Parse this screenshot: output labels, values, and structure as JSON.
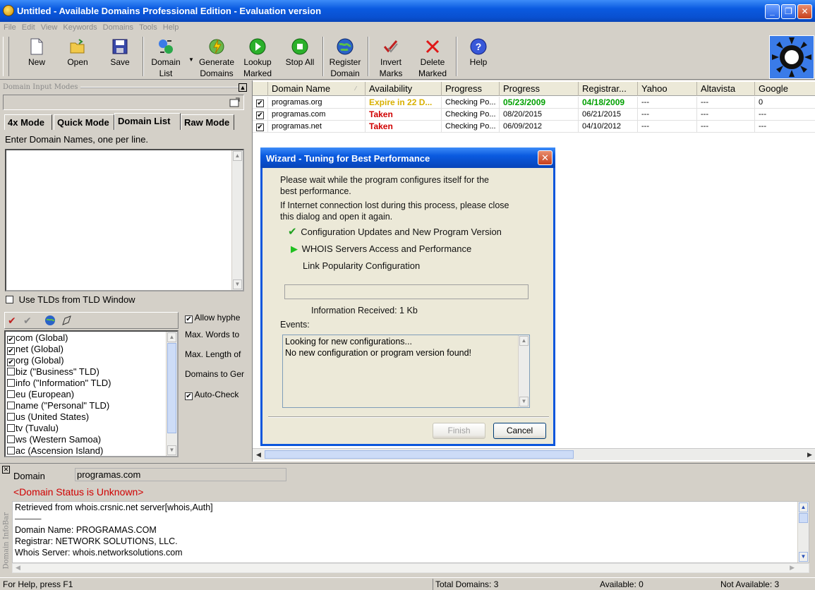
{
  "window": {
    "title": "Untitled - Available Domains Professional Edition - Evaluation version",
    "controls": [
      "_",
      "❐",
      "✕"
    ]
  },
  "menu": [
    "File",
    "Edit",
    "View",
    "Keywords",
    "Domains",
    "Tools",
    "Help"
  ],
  "toolbar": {
    "new": "New",
    "open": "Open",
    "save": "Save",
    "domain_list_1": "Domain",
    "domain_list_2": "List",
    "generate_1": "Generate",
    "generate_2": "Domains",
    "lookup_1": "Lookup",
    "lookup_2": "Marked",
    "stop_all": "Stop All",
    "register_1": "Register",
    "register_2": "Domain",
    "invert_1": "Invert",
    "invert_2": "Marks",
    "delete_1": "Delete",
    "delete_2": "Marked",
    "help": "Help",
    "icons": {
      "new": "new-file-icon",
      "open": "open-folder-icon",
      "save": "floppy-disk-icon",
      "domain_list": "domain-list-icon",
      "generate": "lightning-globe-icon",
      "lookup": "green-play-icon",
      "stop": "green-stop-icon",
      "register": "globe-icon",
      "invert": "check-marks-icon",
      "delete": "red-x-icon",
      "help": "question-icon"
    }
  },
  "left_pane": {
    "title": "Domain Input Modes",
    "tabs": [
      "4x Mode",
      "Quick Mode",
      "Domain List",
      "Raw Mode"
    ],
    "active_tab": "Domain List",
    "instruction": "Enter Domain Names, one per line.",
    "domain_text": "",
    "use_tlds_label": "Use TLDs from TLD Window",
    "use_tlds_checked": false,
    "tld_list": [
      {
        "label": "com (Global)",
        "checked": true
      },
      {
        "label": "net (Global)",
        "checked": true
      },
      {
        "label": "org (Global)",
        "checked": true
      },
      {
        "label": "biz (\"Business\" TLD)",
        "checked": false
      },
      {
        "label": "info (\"Information\" TLD)",
        "checked": false
      },
      {
        "label": "eu (European)",
        "checked": false
      },
      {
        "label": "name (\"Personal\" TLD)",
        "checked": false
      },
      {
        "label": "us (United States)",
        "checked": false
      },
      {
        "label": "tv (Tuvalu)",
        "checked": false
      },
      {
        "label": "ws (Western Samoa)",
        "checked": false
      },
      {
        "label": "ac (Ascension Island)",
        "checked": false
      }
    ],
    "options": {
      "allow_hyphens": "Allow hyphe",
      "max_words": "Max. Words to",
      "max_length": "Max. Length of",
      "domains_to_gen": "Domains to Ger",
      "auto_check": "Auto-Check"
    }
  },
  "grid": {
    "columns": [
      "Domain Name",
      "Availability",
      "Progress",
      "Progress",
      "Registrar...",
      "Yahoo",
      "Altavista",
      "Google"
    ],
    "rows": [
      {
        "checked": true,
        "domain": "programas.org",
        "availability": "Expire in 22 D...",
        "status": "Checking Po...",
        "date1": "05/23/2009",
        "date2": "04/18/2009",
        "yahoo": "---",
        "altavista": "---",
        "google": "0"
      },
      {
        "checked": true,
        "domain": "programas.com",
        "availability": "Taken",
        "status": "Checking Po...",
        "date1": "08/20/2015",
        "date2": "06/21/2015",
        "yahoo": "---",
        "altavista": "---",
        "google": "---"
      },
      {
        "checked": true,
        "domain": "programas.net",
        "availability": "Taken",
        "status": "Checking Po...",
        "date1": "06/09/2012",
        "date2": "04/10/2012",
        "yahoo": "---",
        "altavista": "---",
        "google": "---"
      }
    ]
  },
  "dialog": {
    "title": "Wizard - Tuning for Best Performance",
    "intro_1": "Please wait while the program configures itself for the",
    "intro_2": "best performance.",
    "note_1": "If Internet connection lost during this process, please close",
    "note_2": "this dialog and open it again.",
    "steps": [
      {
        "label": "Configuration Updates and New Program Version",
        "state": "done"
      },
      {
        "label": "WHOIS Servers Access and Performance",
        "state": "current"
      },
      {
        "label": "Link Popularity Configuration",
        "state": "pending"
      }
    ],
    "info_received": "Information Received: 1 Kb",
    "events_label": "Events:",
    "events": [
      "Looking for new configurations...",
      "No new configuration or program version found!"
    ],
    "finish": "Finish",
    "cancel": "Cancel",
    "progress": 0
  },
  "infobar": {
    "vertical_label": "Domain InfoBar",
    "domain_label": "Domain",
    "domain_value": "programas.com",
    "status": "<Domain Status is Unknown>",
    "whois_lines": [
      "Retrieved from whois.crsnic.net server[whois,Auth]",
      "———",
      "Domain Name: PROGRAMAS.COM",
      "Registrar: NETWORK SOLUTIONS, LLC.",
      "Whois Server: whois.networksolutions.com"
    ]
  },
  "statusbar": {
    "help": "For Help, press F1",
    "total": "Total Domains: 3",
    "available": "Available: 0",
    "not_available": "Not Available: 3"
  }
}
